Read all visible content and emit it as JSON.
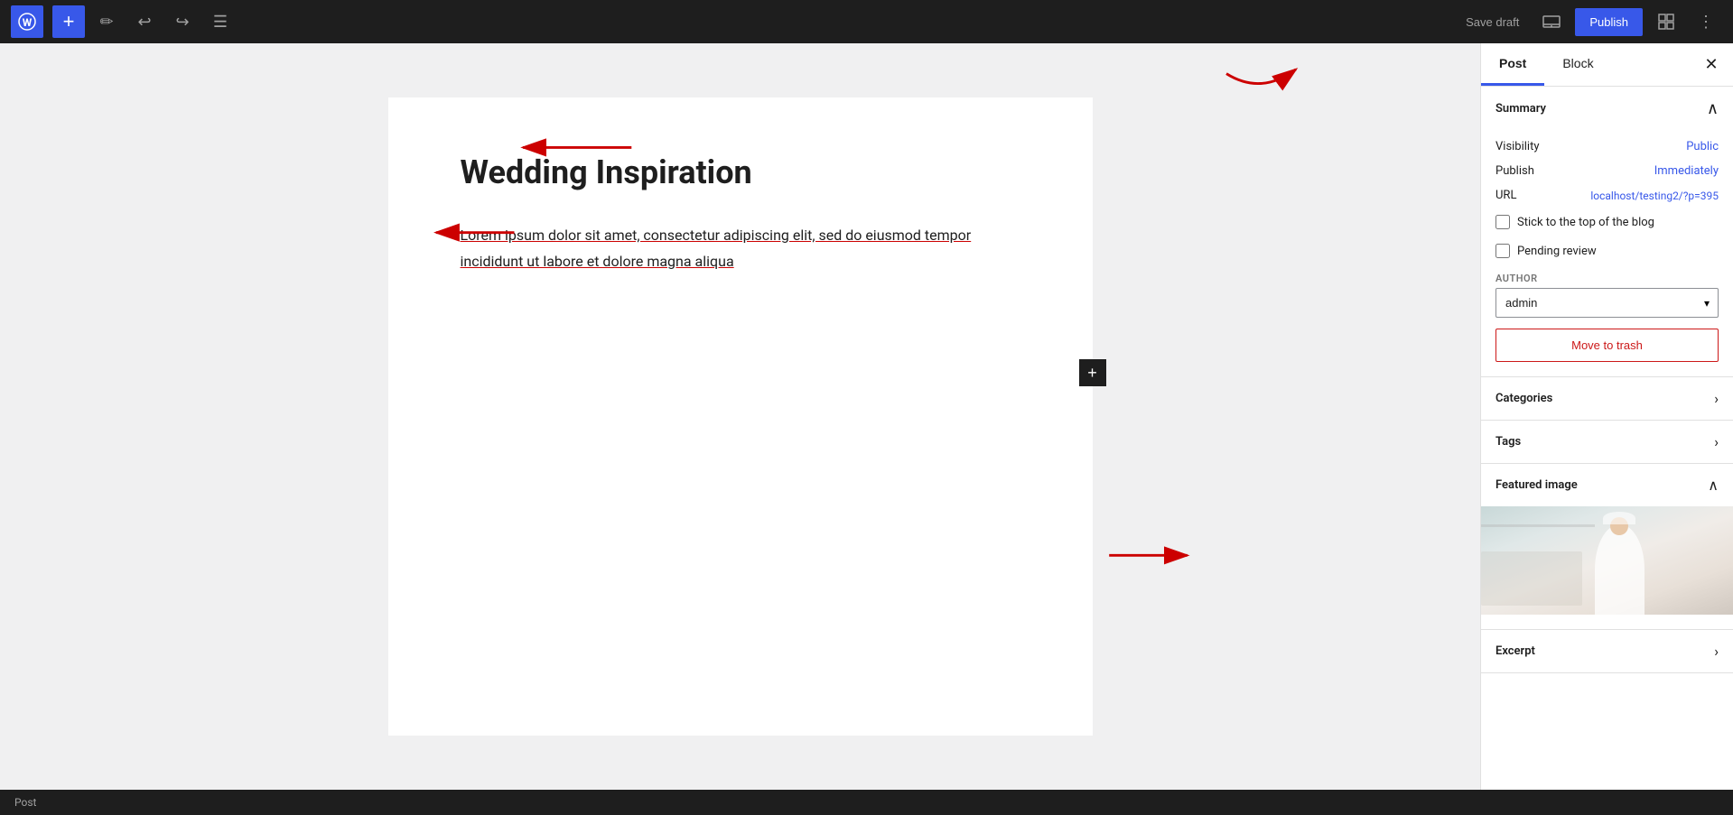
{
  "toolbar": {
    "wp_logo": "W",
    "add_label": "+",
    "save_draft_label": "Save draft",
    "publish_label": "Publish",
    "tools_icon": "✏",
    "undo_icon": "↩",
    "redo_icon": "↪",
    "list_view_icon": "☰"
  },
  "editor": {
    "post_title": "Wedding Inspiration",
    "post_body": "Lorem ipsum dolor sit amet, consectetur adipiscing elit, sed do eiusmod tempor incididunt ut labore et dolore magna aliqua"
  },
  "sidebar": {
    "tab_post": "Post",
    "tab_block": "Block",
    "close_icon": "✕",
    "summary_title": "Summary",
    "visibility_label": "Visibility",
    "visibility_value": "Public",
    "publish_label": "Publish",
    "publish_value": "Immediately",
    "url_label": "URL",
    "url_value": "localhost/testing2/?p=395",
    "stick_top_label": "Stick to the top of the blog",
    "pending_review_label": "Pending review",
    "author_label": "AUTHOR",
    "author_value": "admin",
    "move_to_trash_label": "Move to trash",
    "categories_label": "Categories",
    "tags_label": "Tags",
    "featured_image_label": "Featured image",
    "excerpt_label": "Excerpt",
    "chevron_down": "›",
    "chevron_up": "‹"
  },
  "status_bar": {
    "label": "Post"
  }
}
